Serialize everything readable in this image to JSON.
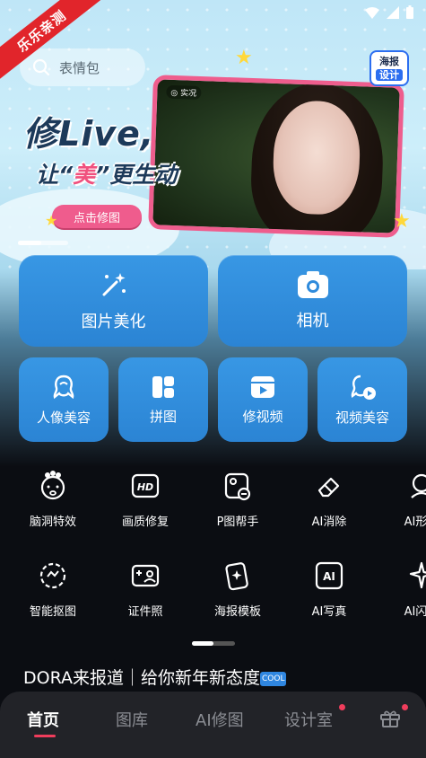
{
  "corner_badge": "乐乐亲测",
  "search": {
    "placeholder": "表情包"
  },
  "banner": {
    "headline_line1": "修Live,",
    "headline_line2_pre": "让“",
    "headline_line2_mid": "美",
    "headline_line2_post": "”更生动",
    "cta": "点击修图",
    "live_tag": "◎ 实况",
    "poster_badge_top": "海报",
    "poster_badge_bottom": "设计"
  },
  "primary_actions": [
    {
      "label": "图片美化",
      "icon": "magic-wand-icon"
    },
    {
      "label": "相机",
      "icon": "camera-icon"
    }
  ],
  "secondary_actions": [
    {
      "label": "人像美容",
      "icon": "portrait-icon"
    },
    {
      "label": "拼图",
      "icon": "collage-icon"
    },
    {
      "label": "修视频",
      "icon": "video-edit-icon"
    },
    {
      "label": "视频美容",
      "icon": "video-beauty-icon"
    }
  ],
  "tools_row1": [
    {
      "label": "脑洞特效",
      "icon": "brain-effect-icon"
    },
    {
      "label": "画质修复",
      "icon": "hd-icon"
    },
    {
      "label": "P图帮手",
      "icon": "photo-helper-icon"
    },
    {
      "label": "AI消除",
      "icon": "eraser-icon"
    },
    {
      "label": "AI形象",
      "icon": "ai-avatar-icon"
    }
  ],
  "tools_row2": [
    {
      "label": "智能抠图",
      "icon": "smart-cutout-icon"
    },
    {
      "label": "证件照",
      "icon": "id-photo-icon"
    },
    {
      "label": "海报模板",
      "icon": "poster-template-icon"
    },
    {
      "label": "AI写真",
      "icon": "ai-portrait-icon"
    },
    {
      "label": "AI闪光",
      "icon": "ai-flash-icon"
    }
  ],
  "news": {
    "text": "DORA来报道｜给你新年新态度",
    "badge": "COOL"
  },
  "bottom_nav": [
    {
      "label": "首页",
      "active": true
    },
    {
      "label": "图库",
      "active": false
    },
    {
      "label": "AI修图",
      "active": false
    },
    {
      "label": "设计室",
      "active": false,
      "dot": true
    },
    {
      "label": "gift",
      "active": false,
      "dot": true
    }
  ],
  "colors": {
    "accent": "#2b84d4",
    "pink": "#ef5c8d",
    "nav_active": "#f03d5c"
  }
}
